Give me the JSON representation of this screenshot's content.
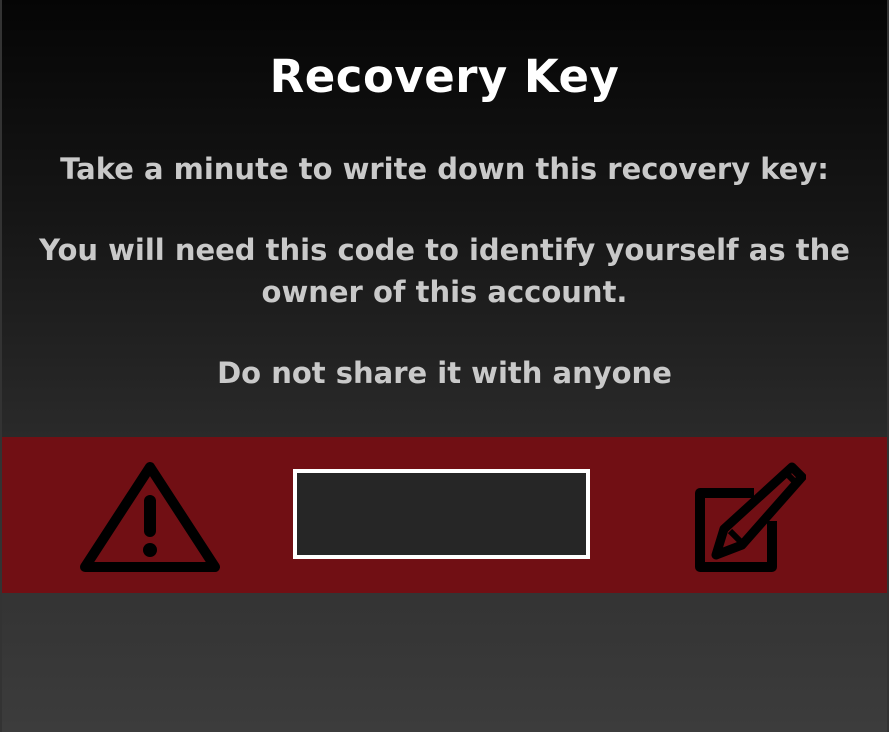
{
  "dialog": {
    "title": "Recovery Key",
    "instruction": "Take a minute to write down this recovery key:",
    "explanation": "You will need this code to identify yourself as the owner of this account.",
    "warning_text": "Do not share it with anyone"
  },
  "key_panel": {
    "recovery_key_value": "",
    "warning_icon": "warning-triangle-icon",
    "edit_icon": "edit-pencil-icon",
    "band_color": "#710f14"
  }
}
